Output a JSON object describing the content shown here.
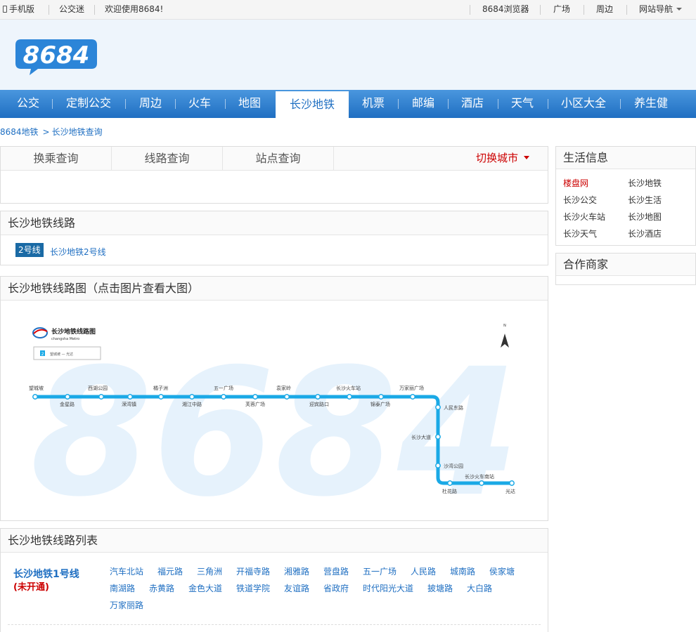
{
  "topbar": {
    "mobile": "手机版",
    "fans": "公交迷",
    "welcome": "欢迎使用8684!",
    "browser": "8684浏览器",
    "square": "广场",
    "nearby": "周边",
    "sitenav": "网站导航"
  },
  "logo": {
    "text": "8684"
  },
  "nav": {
    "items": [
      "公交",
      "定制公交",
      "周边",
      "火车",
      "地图",
      "长沙地铁",
      "机票",
      "邮编",
      "酒店",
      "天气",
      "小区大全",
      "养生健"
    ],
    "active_index": 5
  },
  "breadcrumb": {
    "root": "8684地铁",
    "current": "长沙地铁查询"
  },
  "search": {
    "tabs": [
      "换乘查询",
      "线路查询",
      "站点查询"
    ],
    "switch_city": "切换城市"
  },
  "lines_panel": {
    "title": "长沙地铁线路",
    "badge": "2号线",
    "link": "长沙地铁2号线"
  },
  "map_panel": {
    "title": "长沙地铁线路图（点击图片查看大图）",
    "map_title": "长沙地铁线路图",
    "map_subtitle": "changsha Metro",
    "watermark": "8684",
    "legend_num": "2",
    "legend_text": "望城坡 — 光达",
    "stations_top": [
      "望城坡",
      "西湖公园",
      "橘子洲",
      "五一广场",
      "袁家岭",
      "长沙火车站",
      "万家丽广场"
    ],
    "stations_bottom": [
      "金星路",
      "溁湾镇",
      "湘江中路",
      "芙蓉广场",
      "迎宾路口",
      "锦泰广场"
    ],
    "stations_vertical": [
      "人民东路",
      "长沙大道",
      "沙湾公园"
    ],
    "stations_bottom_line": [
      "长沙火车南站",
      "杜花路",
      "光达"
    ]
  },
  "line_list": {
    "title": "长沙地铁线路列表",
    "line_name": "长沙地铁1号线",
    "line_status": "(未开通)",
    "stations": [
      "汽车北站",
      "福元路",
      "三角洲",
      "开福寺路",
      "湘雅路",
      "营盘路",
      "五一广场",
      "人民路",
      "城南路",
      "侯家塘",
      "南湖路",
      "赤黄路",
      "金色大道",
      "铁道学院",
      "友谊路",
      "省政府",
      "时代阳光大道",
      "披塘路",
      "大白路",
      "万家丽路"
    ]
  },
  "sidebar": {
    "life_title": "生活信息",
    "links": [
      "楼盘网",
      "长沙地铁",
      "长沙公交",
      "长沙生活",
      "长沙火车站",
      "长沙地图",
      "长沙天气",
      "长沙酒店"
    ],
    "partner_title": "合作商家"
  },
  "colors": {
    "brand": "#1f6fc2",
    "metro_line": "#1aa9e6",
    "accent_red": "#cc0000"
  }
}
